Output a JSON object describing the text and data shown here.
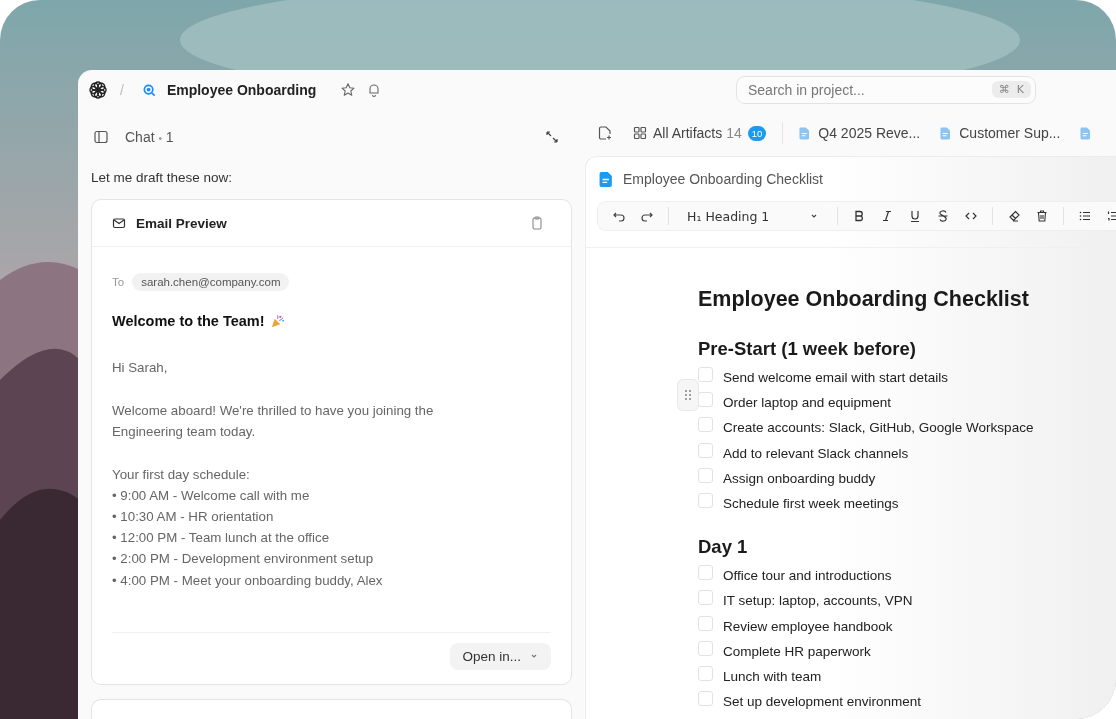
{
  "topbar": {
    "separator": "/",
    "project": "Employee Onboarding"
  },
  "search": {
    "placeholder": "Search in project...",
    "shortcut": [
      "⌘",
      "K"
    ]
  },
  "chat": {
    "title": "Chat",
    "dot": "•",
    "count": "1",
    "message": "Let me draft these now:",
    "email": {
      "title": "Email Preview",
      "to_label": "To",
      "to": "sarah.chen@company.com",
      "subject": "Welcome to the Team!",
      "greeting": "Hi Sarah,",
      "intro": "Welcome aboard! We're thrilled to have you joining the Engineering team today.",
      "schedule_title": "Your first day schedule:",
      "schedule": [
        "• 9:00 AM - Welcome call with me",
        "• 10:30 AM - HR orientation",
        "• 12:00 PM - Team lunch at the office",
        "• 2:00 PM - Development environment setup",
        "• 4:00 PM - Meet your onboarding buddy, Alex"
      ],
      "open_button": "Open in..."
    }
  },
  "artifacts": {
    "all_label": "All Artifacts",
    "all_count": "14",
    "badge": "10",
    "tabs": [
      {
        "kind": "doc",
        "label": "Q4 2025 Reve..."
      },
      {
        "kind": "doc",
        "label": "Customer Sup..."
      },
      {
        "kind": "icon-only"
      }
    ]
  },
  "document": {
    "title": "Employee Onboarding Checklist",
    "block_style": "H₁ Heading 1",
    "heading": "Employee Onboarding Checklist",
    "sections": [
      {
        "heading": "Pre-Start (1 week before)",
        "items": [
          {
            "text": "Send welcome email with start details",
            "checked": false
          },
          {
            "text": "Order laptop and equipment",
            "checked": false
          },
          {
            "text": "Create accounts: Slack, GitHub, Google Workspace",
            "checked": false
          },
          {
            "text": "Add to relevant Slack channels",
            "checked": false
          },
          {
            "text": "Assign onboarding buddy",
            "checked": false
          },
          {
            "text": "Schedule first week meetings",
            "checked": false
          }
        ]
      },
      {
        "heading": "Day 1",
        "items": [
          {
            "text": "Office tour and introductions",
            "checked": false
          },
          {
            "text": "IT setup: laptop, accounts, VPN",
            "checked": false
          },
          {
            "text": "Review employee handbook",
            "checked": false
          },
          {
            "text": "Complete HR paperwork",
            "checked": false
          },
          {
            "text": "Lunch with team",
            "checked": false
          },
          {
            "text": "Set up development environment",
            "checked": false
          }
        ]
      }
    ]
  }
}
